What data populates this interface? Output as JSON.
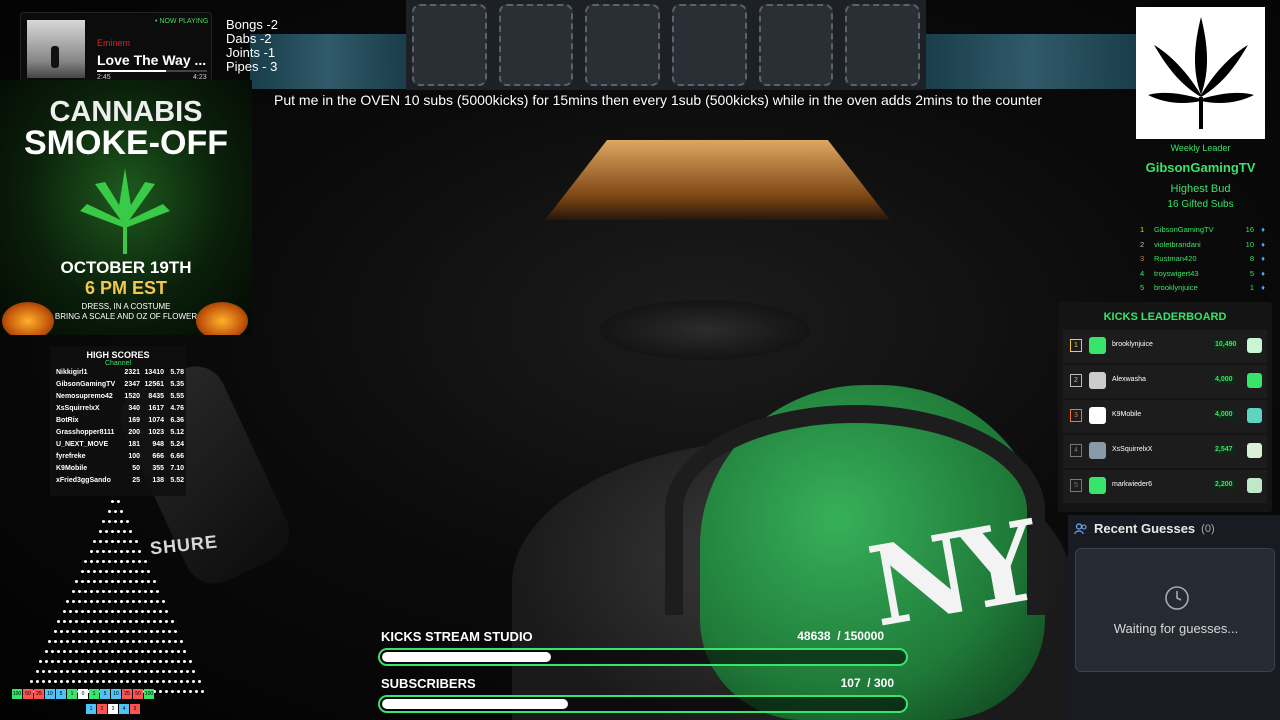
{
  "now_playing": {
    "badge": "• NOW PLAYING",
    "artist": "Eminem",
    "title": "Love The Way ...",
    "elapsed": "2:45",
    "duration": "4:23",
    "progress": 0.63
  },
  "counters": [
    "Bongs -2",
    "Dabs -2",
    "Joints -1",
    "Pipes - 3"
  ],
  "banner": "Put me in the OVEN 10 subs (5000kicks) for 15mins then every 1sub (500kicks) while in the oven adds 2mins to the counter",
  "poster": {
    "title_line1": "CANNABIS",
    "title_line2": "SMOKE-OFF",
    "date": "OCTOBER 19TH",
    "time": "6 PM EST",
    "line1": "DRESS, IN A COSTUME",
    "line2": "BRING A SCALE AND OZ OF FLOWER"
  },
  "high_scores": {
    "title": "HIGH SCORES",
    "subtitle": "Channel",
    "rows": [
      {
        "name": "Nikkigirl1",
        "a": "2321",
        "b": "13410",
        "c": "5.78"
      },
      {
        "name": "GibsonGamingTV",
        "a": "2347",
        "b": "12561",
        "c": "5.35"
      },
      {
        "name": "Nemosupremo42",
        "a": "1520",
        "b": "8435",
        "c": "5.55"
      },
      {
        "name": "XsSquirrelxX",
        "a": "340",
        "b": "1617",
        "c": "4.76"
      },
      {
        "name": "BotRix",
        "a": "169",
        "b": "1074",
        "c": "6.36"
      },
      {
        "name": "Grasshopper8111",
        "a": "200",
        "b": "1023",
        "c": "5.12"
      },
      {
        "name": "U_NEXT_MOVE",
        "a": "181",
        "b": "948",
        "c": "5.24"
      },
      {
        "name": "fyrefreke",
        "a": "100",
        "b": "666",
        "c": "6.66"
      },
      {
        "name": "K9Mobile",
        "a": "50",
        "b": "355",
        "c": "7.10"
      },
      {
        "name": "xFried3ggSando",
        "a": "25",
        "b": "138",
        "c": "5.52"
      }
    ]
  },
  "plinko_buckets": [
    "100",
    "50",
    "25",
    "10",
    "5",
    "1",
    "0",
    "1",
    "5",
    "10",
    "25",
    "50",
    "100"
  ],
  "plinko_buckets2": [
    "1",
    "2",
    "3",
    "4",
    "5"
  ],
  "weekly_leader": {
    "label": "Weekly Leader",
    "name": "GibsonGamingTV",
    "highest_bud": "Highest Bud",
    "gifted": "16 Gifted Subs",
    "gifters": [
      {
        "rank": "1",
        "name": "GibsonGamingTV",
        "count": "16"
      },
      {
        "rank": "2",
        "name": "violetbrandani",
        "count": "10"
      },
      {
        "rank": "3",
        "name": "Rustman420",
        "count": "8"
      },
      {
        "rank": "4",
        "name": "troyswigert43",
        "count": "5"
      },
      {
        "rank": "5",
        "name": "brooklynjuice",
        "count": "1"
      }
    ]
  },
  "kicks_leaderboard": {
    "title": "KICKS LEADERBOARD",
    "rows": [
      {
        "rank": "1",
        "name": "brooklynjuice",
        "value": "10,490"
      },
      {
        "rank": "2",
        "name": "Alexwasha",
        "value": "4,000"
      },
      {
        "rank": "3",
        "name": "K9Mobile",
        "value": "4,000"
      },
      {
        "rank": "4",
        "name": "XsSquirrelxX",
        "value": "2,547"
      },
      {
        "rank": "5",
        "name": "markwieder6",
        "value": "2,200"
      }
    ]
  },
  "recent_guesses": {
    "title": "Recent Guesses",
    "count": "(0)",
    "waiting": "Waiting for guesses..."
  },
  "goals": [
    {
      "label": "KICKS STREAM STUDIO",
      "current": "48638",
      "target": "/ 150000",
      "progress": 0.324
    },
    {
      "label": "SUBSCRIBERS",
      "current": "107",
      "target": "/ 300",
      "progress": 0.357
    }
  ],
  "colors": {
    "accent": "#39e46a"
  }
}
